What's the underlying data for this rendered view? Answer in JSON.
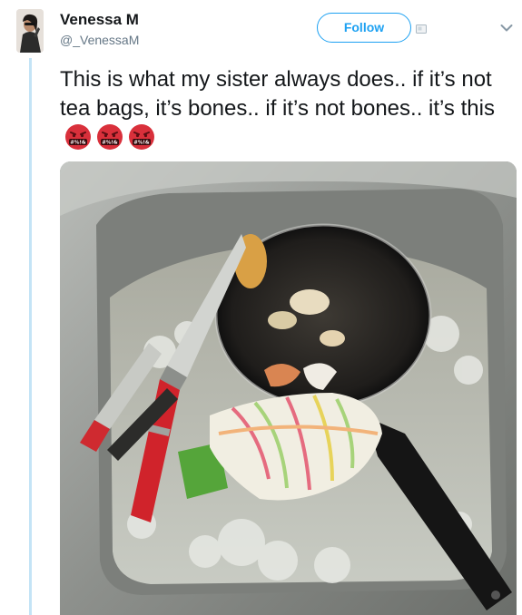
{
  "tweet": {
    "display_name": "Venessa M",
    "handle": "@_VenessaM",
    "follow_label": "Follow",
    "text": "This is what my sister always does.. if it’s not tea bags, it’s bones.. if it’s not bones.. it’s this",
    "emoji": [
      "swearing-face-emoji",
      "swearing-face-emoji",
      "swearing-face-emoji"
    ],
    "emoji_glyph_text": "#%!&"
  },
  "colors": {
    "accent": "#1da1f2",
    "text": "#14171a",
    "secondary_text": "#657786",
    "thread_line": "#c4e4f6",
    "emoji_red": "#d9303b"
  },
  "icons": [
    "chevron-down-icon",
    "card-icon"
  ]
}
